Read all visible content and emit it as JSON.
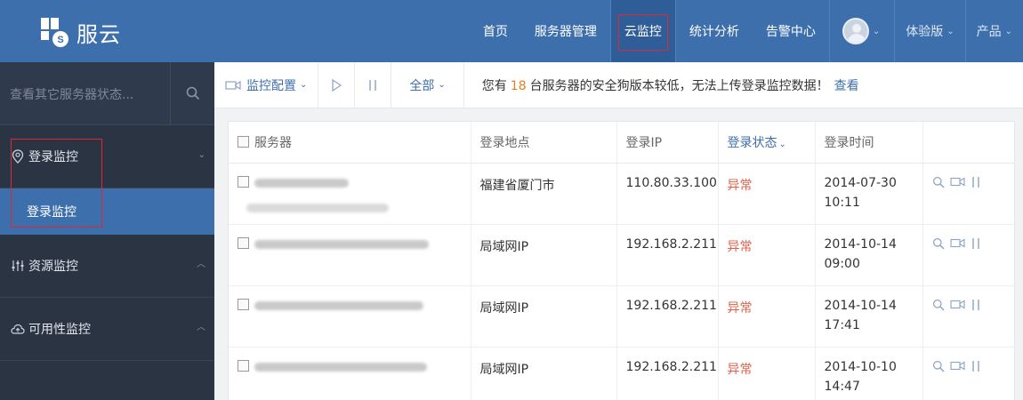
{
  "app": {
    "name": "服云"
  },
  "nav": {
    "items": [
      {
        "label": "首页"
      },
      {
        "label": "服务器管理"
      },
      {
        "label": "云监控",
        "active": true
      },
      {
        "label": "统计分析"
      },
      {
        "label": "告警中心"
      }
    ],
    "edition": "体验版",
    "product": "产品"
  },
  "sidebar": {
    "search_placeholder": "查看其它服务器状态...",
    "groups": [
      {
        "label": "登录监控",
        "icon": "location-pin-icon",
        "expanded": true,
        "sub": [
          "登录监控"
        ]
      },
      {
        "label": "资源监控",
        "icon": "sliders-icon",
        "expanded": false
      },
      {
        "label": "可用性监控",
        "icon": "cloud-icon",
        "expanded": false
      }
    ]
  },
  "toolbar": {
    "config_label": "监控配置",
    "filter_label": "全部",
    "notice_prefix": "您有",
    "notice_count": "18",
    "notice_suffix": "台服务器的安全狗版本较低，无法上传登录监控数据！",
    "notice_link": "查看"
  },
  "table": {
    "columns": [
      "服务器",
      "登录地点",
      "登录IP",
      "登录状态",
      "登录时间"
    ],
    "rows": [
      {
        "location": "福建省厦门市",
        "ip": "110.80.33.100",
        "status": "异常",
        "date": "2014-07-30",
        "time": "10:11"
      },
      {
        "location": "局域网IP",
        "ip": "192.168.2.211",
        "status": "异常",
        "date": "2014-10-14",
        "time": "09:00"
      },
      {
        "location": "局域网IP",
        "ip": "192.168.2.211",
        "status": "异常",
        "date": "2014-10-14",
        "time": "17:41"
      },
      {
        "location": "局域网IP",
        "ip": "192.168.2.211",
        "status": "异常",
        "date": "2014-10-10",
        "time": "14:47"
      }
    ]
  },
  "colors": {
    "brand": "#3d6fad",
    "sidebar": "#2b3443",
    "alert": "#e0614a",
    "highlight": "#e0282f"
  }
}
